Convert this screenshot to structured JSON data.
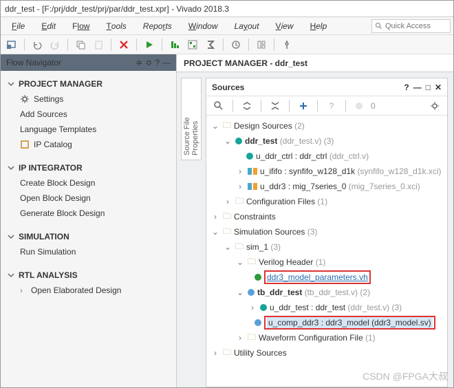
{
  "window": {
    "title": "ddr_test - [F:/prj/ddr_test/prj/par/ddr_test.xpr] - Vivado 2018.3"
  },
  "menu": {
    "file": "ile",
    "edit": "dit",
    "flow": "low",
    "tools": "ools",
    "reports": "Repo",
    "reports2": "ts",
    "window": "indow",
    "layout": "La",
    "layout2": "out",
    "view": "iew",
    "help": "elp",
    "quick_placeholder": "Quick Access"
  },
  "nav": {
    "title": "Flow Navigator",
    "sec_pm": "PROJECT MANAGER",
    "settings": "Settings",
    "add_src": "Add Sources",
    "lang_tpl": "Language Templates",
    "ip_cat": "IP Catalog",
    "sec_ipi": "IP INTEGRATOR",
    "cbd": "Create Block Design",
    "obd": "Open Block Design",
    "gbd": "Generate Block Design",
    "sec_sim": "SIMULATION",
    "run_sim": "Run Simulation",
    "sec_rtl": "RTL ANALYSIS",
    "open_elab": "Open Elaborated Design"
  },
  "pm": {
    "title": "PROJECT MANAGER - ddr_test"
  },
  "sfp": {
    "label": "Source File Properties"
  },
  "sources": {
    "title": "Sources",
    "tb_count": "0",
    "tree": {
      "design_sources": "Design Sources",
      "design_sources_c": "(2)",
      "ddr_test": "ddr_test",
      "ddr_test_f": "(ddr_test.v)",
      "ddr_test_c": "(3)",
      "u_ddr_ctrl": "u_ddr_ctrl : ddr_ctrl",
      "u_ddr_ctrl_f": "(ddr_ctrl.v)",
      "u_ififo": "u_ififo : synfifo_w128_d1k",
      "u_ififo_f": "(synfifo_w128_d1k.xci)",
      "u_ddr3": "u_ddr3 : mig_7series_0",
      "u_ddr3_f": "(mig_7series_0.xci)",
      "cfg_files": "Configuration Files",
      "cfg_files_c": "(1)",
      "constraints": "Constraints",
      "sim_src": "Simulation Sources",
      "sim_src_c": "(3)",
      "sim1": "sim_1",
      "sim1_c": "(3)",
      "vh": "Verilog Header",
      "vh_c": "(1)",
      "ddr3_params": "ddr3_model_parameters.vh",
      "tb": "tb_ddr_test",
      "tb_f": "(tb_ddr_test.v)",
      "tb_c": "(2)",
      "u_ddr_test": "u_ddr_test : ddr_test",
      "u_ddr_test_f": "(ddr_test.v)",
      "u_ddr_test_c": "(3)",
      "u_comp": "u_comp_ddr3 : ddr3_model (ddr3_model.sv)",
      "wave": "Waveform Configuration File",
      "wave_c": "(1)",
      "util": "Utility Sources"
    }
  },
  "watermark": "CSDN @FPGA大叔"
}
